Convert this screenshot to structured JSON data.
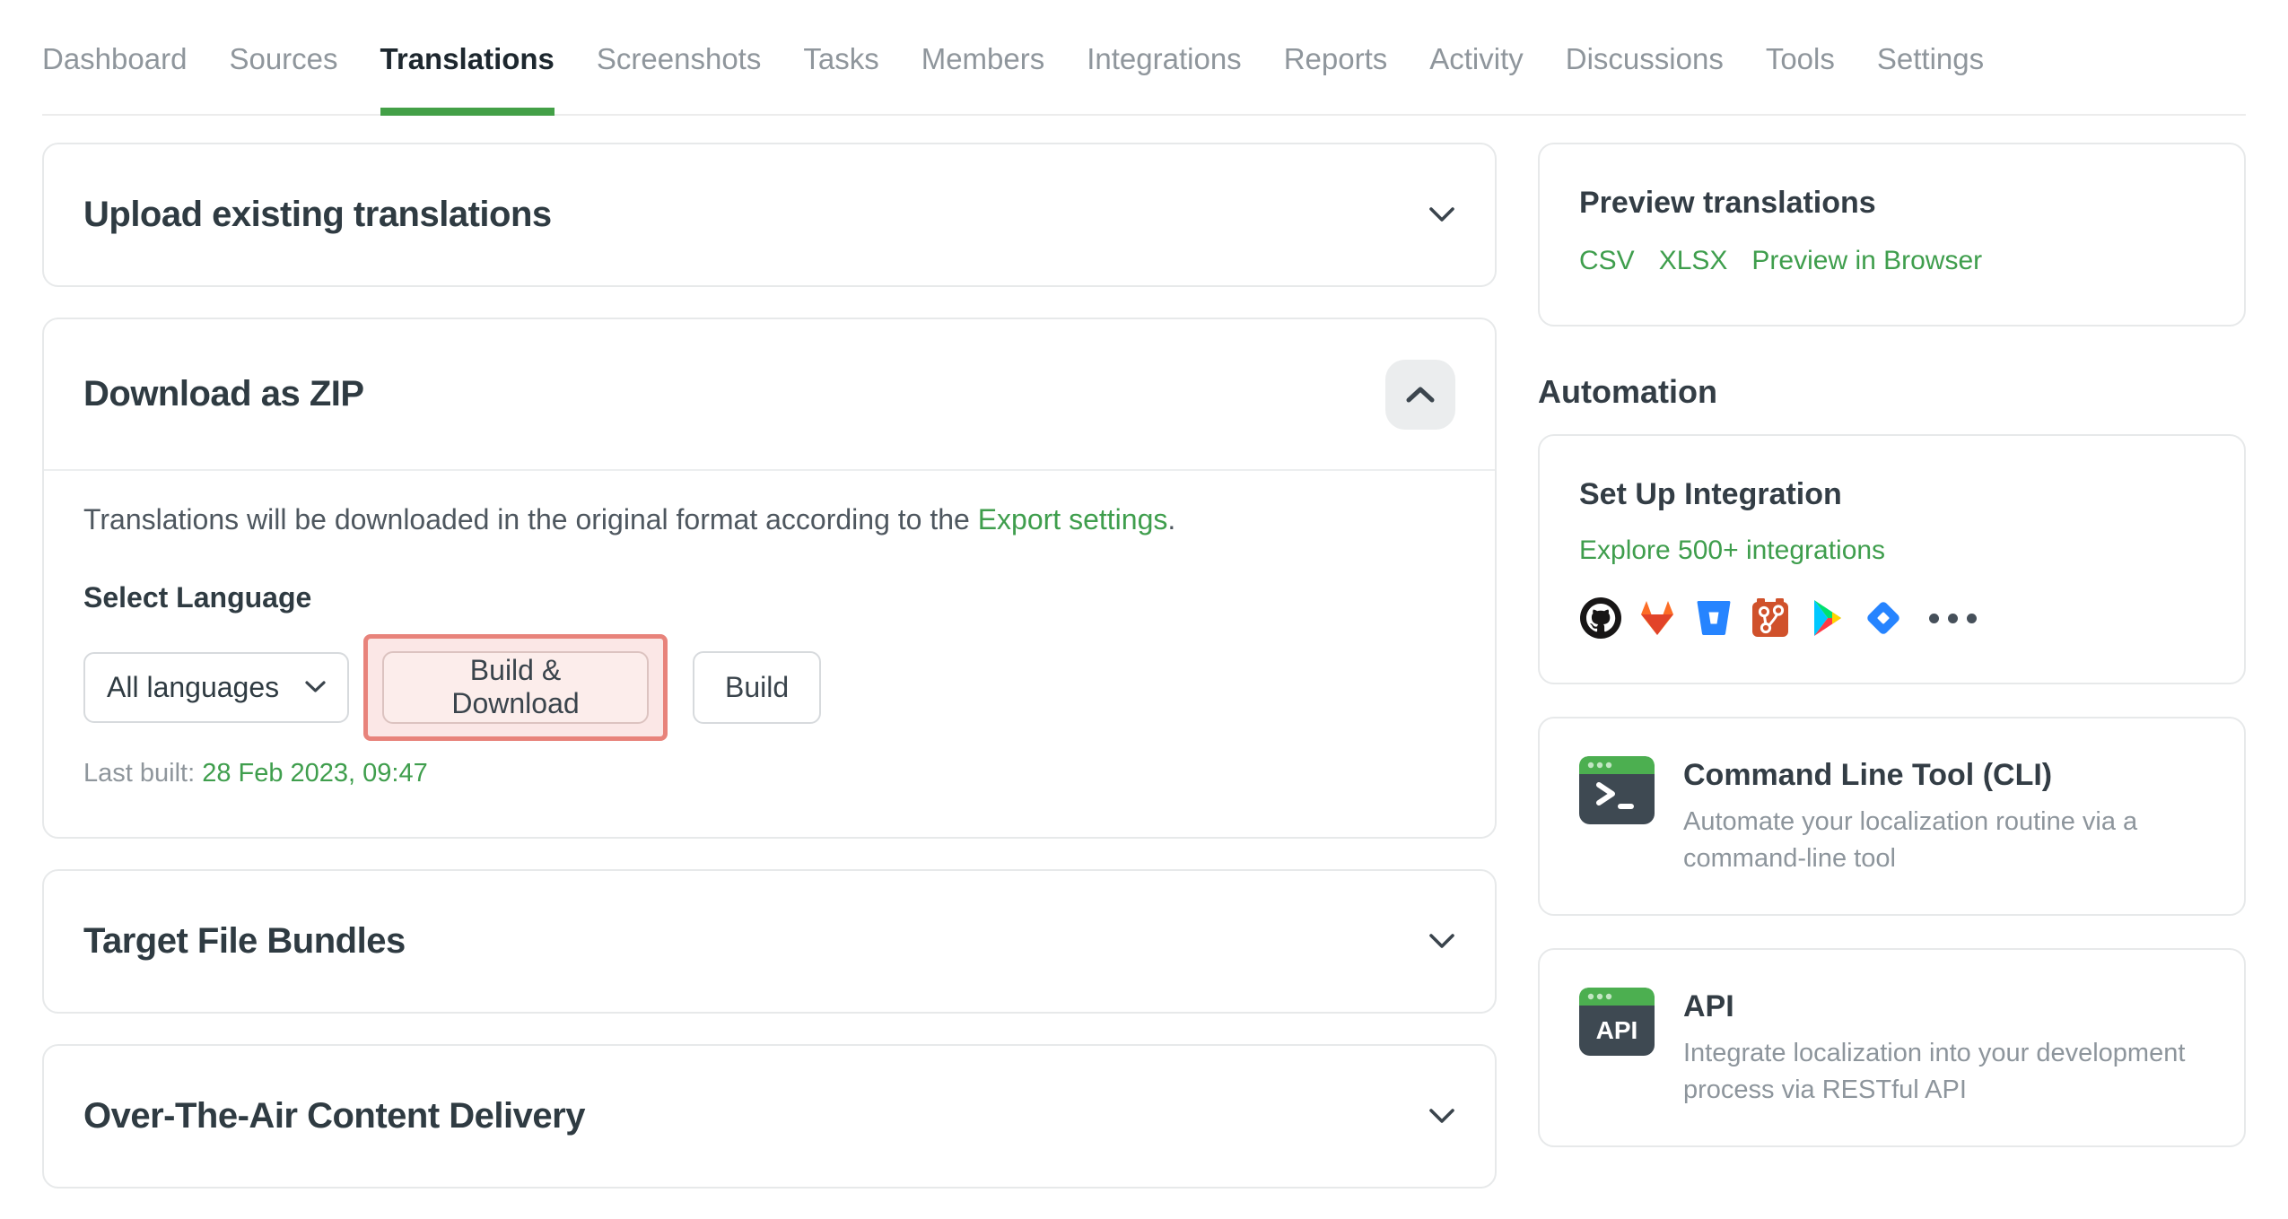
{
  "nav": {
    "items": [
      {
        "label": "Dashboard"
      },
      {
        "label": "Sources"
      },
      {
        "label": "Translations",
        "active": true
      },
      {
        "label": "Screenshots"
      },
      {
        "label": "Tasks"
      },
      {
        "label": "Members"
      },
      {
        "label": "Integrations"
      },
      {
        "label": "Reports"
      },
      {
        "label": "Activity"
      },
      {
        "label": "Discussions"
      },
      {
        "label": "Tools"
      },
      {
        "label": "Settings"
      }
    ]
  },
  "panels": {
    "upload": {
      "title": "Upload existing translations"
    },
    "download": {
      "title": "Download as ZIP",
      "description_prefix": "Translations will be downloaded in the original format according to the ",
      "description_link": "Export settings",
      "description_suffix": ".",
      "select_label": "Select Language",
      "select_value": "All languages",
      "build_download_label": "Build & Download",
      "build_label": "Build",
      "last_built_label": "Last built: ",
      "last_built_value": "28 Feb 2023, 09:47"
    },
    "target_bundles": {
      "title": "Target File Bundles"
    },
    "ota": {
      "title": "Over-The-Air Content Delivery"
    }
  },
  "sidebar": {
    "preview": {
      "title": "Preview translations",
      "links": [
        "CSV",
        "XLSX",
        "Preview in Browser"
      ]
    },
    "automation_heading": "Automation",
    "integration": {
      "title": "Set Up Integration",
      "link": "Explore 500+ integrations",
      "icons": [
        "github-icon",
        "gitlab-icon",
        "bitbucket-icon",
        "git-icon",
        "google-play-icon",
        "jira-icon",
        "more-icon"
      ]
    },
    "cli": {
      "title": "Command Line Tool (CLI)",
      "description": "Automate your localization routine via a command-line tool",
      "icon_glyph": ">_"
    },
    "api": {
      "title": "API",
      "description": "Integrate localization into your development process via RESTful API",
      "icon_glyph": "API"
    }
  },
  "colors": {
    "accent_green": "#43a047",
    "link_green": "#3f9e4d",
    "annotation_red": "#e8837b",
    "title_dark": "#2f3b42"
  }
}
